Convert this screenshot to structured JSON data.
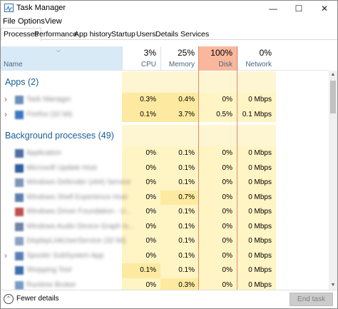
{
  "window": {
    "title": "Task Manager",
    "min_glyph": "—",
    "max_glyph": "☐",
    "close_glyph": "✕"
  },
  "menu": [
    "File",
    "Options",
    "View"
  ],
  "tabs": [
    "Processes",
    "Performance",
    "App history",
    "Startup",
    "Users",
    "Details",
    "Services"
  ],
  "active_tab": "Processes",
  "columns": {
    "name": "Name",
    "cpu": {
      "pct": "3%",
      "label": "CPU"
    },
    "memory": {
      "pct": "25%",
      "label": "Memory"
    },
    "disk": {
      "pct": "100%",
      "label": "Disk"
    },
    "network": {
      "pct": "0%",
      "label": "Network"
    }
  },
  "groups": {
    "apps": "Apps (2)",
    "background": "Background processes (49)"
  },
  "apps": [
    {
      "name": "Task Manager",
      "cpu": "0.3%",
      "memory": "0.4%",
      "disk": "0%",
      "network": "0 Mbps",
      "expandable": true
    },
    {
      "name": "Firefox (32 bit)",
      "cpu": "0.1%",
      "memory": "3.7%",
      "disk": "0.5%",
      "network": "0.1 Mbps",
      "expandable": true
    }
  ],
  "background": [
    {
      "name": "Application",
      "cpu": "0%",
      "memory": "0.1%",
      "disk": "0%",
      "network": "0 Mbps"
    },
    {
      "name": "Microsoft Update Host",
      "cpu": "0%",
      "memory": "0.1%",
      "disk": "0%",
      "network": "0 Mbps"
    },
    {
      "name": "Windows Defender (x64) Service",
      "cpu": "0%",
      "memory": "0.1%",
      "disk": "0%",
      "network": "0 Mbps"
    },
    {
      "name": "Windows Shell Experience Host",
      "cpu": "0%",
      "memory": "0.7%",
      "disk": "0%",
      "network": "0 Mbps"
    },
    {
      "name": "Windows Driver Foundation - U...",
      "cpu": "0%",
      "memory": "0.1%",
      "disk": "0%",
      "network": "0 Mbps"
    },
    {
      "name": "Windows Audio Device Graph Is...",
      "cpu": "0%",
      "memory": "0.1%",
      "disk": "0%",
      "network": "0 Mbps"
    },
    {
      "name": "DisplayLinkUserService (32 bit)",
      "cpu": "0%",
      "memory": "0.1%",
      "disk": "0%",
      "network": "0 Mbps"
    },
    {
      "name": "Spooler SubSystem App",
      "cpu": "0%",
      "memory": "0.1%",
      "disk": "0%",
      "network": "0 Mbps",
      "expandable": true
    },
    {
      "name": "Shopping Tool",
      "cpu": "0.1%",
      "memory": "0.1%",
      "disk": "0%",
      "network": "0 Mbps"
    },
    {
      "name": "Runtime Broker",
      "cpu": "0%",
      "memory": "0.3%",
      "disk": "0%",
      "network": "0 Mbps"
    }
  ],
  "footer": {
    "fewer_details": "Fewer details",
    "end_task": "End task"
  },
  "colors": {
    "heat_light": "#fff4c4",
    "heat_mid": "#fdeaa0",
    "disk_header": "#f9b89d",
    "name_header": "#d9eaf7",
    "group_title": "#1c5d99"
  }
}
